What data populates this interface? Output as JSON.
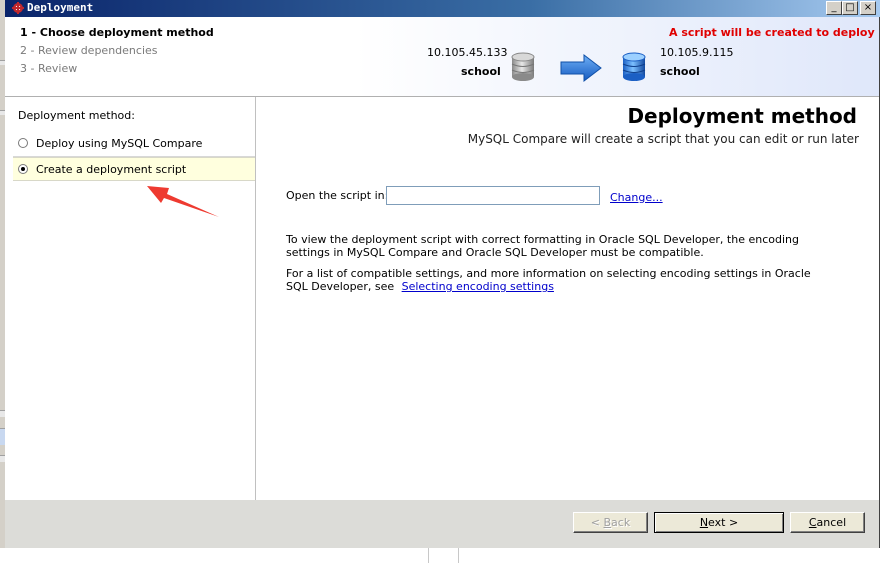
{
  "window": {
    "title": "Deployment",
    "controls": {
      "minimize": "_",
      "maximize": "□",
      "close": "×"
    }
  },
  "steps": [
    {
      "label": "1 - Choose deployment method",
      "active": true
    },
    {
      "label": "2 - Review dependencies",
      "active": false
    },
    {
      "label": "3 - Review",
      "active": false
    }
  ],
  "header": {
    "warning": "A script will be created to deploy",
    "source": {
      "host": "10.105.45.133",
      "database": "school"
    },
    "target": {
      "host": "10.105.9.115",
      "database": "school"
    },
    "colors": {
      "warning": "#e00000",
      "arrow": "#1e6fd9"
    }
  },
  "left_panel": {
    "label": "Deployment method:",
    "options": [
      {
        "label": "Deploy using MySQL Compare",
        "selected": false
      },
      {
        "label": "Create a deployment script",
        "selected": true
      }
    ]
  },
  "main": {
    "title": "Deployment method",
    "subtitle": "MySQL Compare will create a script that you can edit or run later",
    "open_label": "Open the script in:",
    "open_value": "",
    "change_link": "Change...",
    "paragraph1": "To view the deployment script with correct formatting in Oracle SQL Developer, the encoding settings in MySQL Compare and Oracle SQL Developer must be compatible.",
    "paragraph2_text": "For a list of compatible settings, and more information on selecting encoding settings in Oracle SQL Developer, see",
    "paragraph2_link": "Selecting encoding settings"
  },
  "footer": {
    "back": {
      "prefix": "< ",
      "accel": "B",
      "rest": "ack"
    },
    "next": {
      "accel": "N",
      "rest": "ext >"
    },
    "cancel": {
      "accel": "C",
      "rest": "ancel"
    }
  }
}
